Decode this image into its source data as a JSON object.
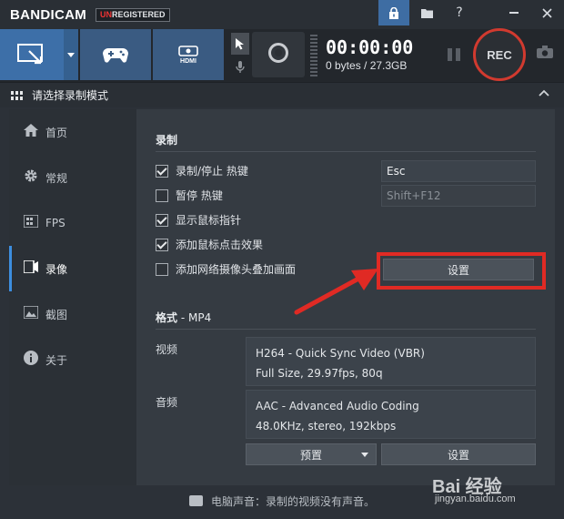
{
  "app": {
    "logo": "BANDICAM",
    "badge_u": "UN",
    "badge_rest": "REGISTERED"
  },
  "titlebar": {
    "buttons": [
      "lock-icon",
      "folder-icon",
      "help-icon",
      "minimize-icon",
      "close-icon"
    ]
  },
  "toolbar": {
    "modes": [
      "screen-mode",
      "game-mode",
      "device-mode"
    ],
    "hdmi_label": "HDMI",
    "timer": "00:00:00",
    "size": "0 bytes / 27.3GB",
    "rec_label": "REC"
  },
  "section": {
    "title": "请选择录制模式"
  },
  "sidebar": {
    "items": [
      {
        "label": "首页",
        "icon": "home-icon"
      },
      {
        "label": "常规",
        "icon": "gear-icon"
      },
      {
        "label": "FPS",
        "icon": "fps-icon"
      },
      {
        "label": "录像",
        "icon": "video-icon"
      },
      {
        "label": "截图",
        "icon": "image-icon"
      },
      {
        "label": "关于",
        "icon": "info-icon"
      }
    ],
    "active": "录像"
  },
  "record": {
    "heading": "录制",
    "options": [
      {
        "label": "录制/停止 热键",
        "checked": true
      },
      {
        "label": "暂停 热键",
        "checked": false
      },
      {
        "label": "显示鼠标指针",
        "checked": true
      },
      {
        "label": "添加鼠标点击效果",
        "checked": true
      },
      {
        "label": "添加网络摄像头叠加画面",
        "checked": false
      }
    ],
    "hotkey_record": "Esc",
    "hotkey_pause": "Shift+F12",
    "settings_button": "设置"
  },
  "format": {
    "heading": "格式",
    "container": " - MP4",
    "video_label": "视频",
    "video_line1": "H264 - Quick Sync Video (VBR)",
    "video_line2": "Full Size, 29.97fps, 80q",
    "audio_label": "音频",
    "audio_line1": "AAC - Advanced Audio Coding",
    "audio_line2": "48.0KHz, stereo, 192kbps",
    "preset_button": "预置",
    "settings_button": "设置"
  },
  "footer": {
    "text": "电脑声音：录制的视频没有声音。"
  },
  "watermark": {
    "brand": "Bai 经验",
    "url": "jingyan.baidu.com"
  },
  "colors": {
    "accent": "#3d6fa8",
    "rec_ring": "#d13a2f",
    "highlight": "#e02a24",
    "arrow": "#e02a24"
  }
}
